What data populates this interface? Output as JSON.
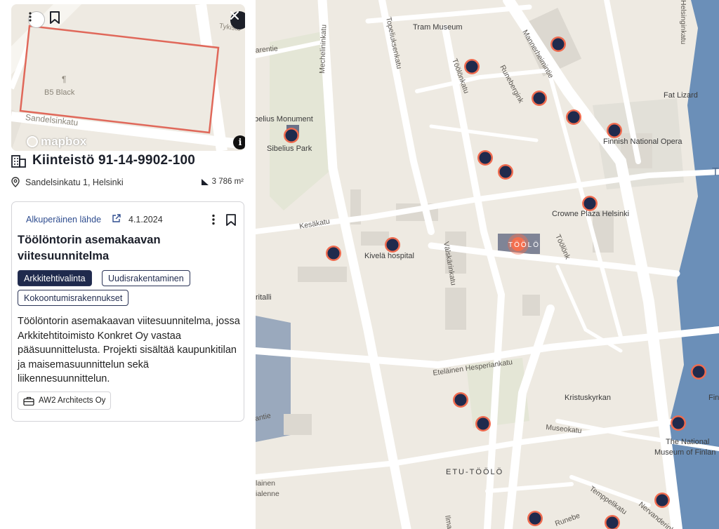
{
  "panel": {
    "title": "Kiinteistö 91-14-9902-100",
    "address": "Sandelsinkatu 1, Helsinki",
    "area": "3 786 m²",
    "mini_map": {
      "labels": {
        "street": "Sandelsinkatu",
        "restaurant": "B5 Black",
        "street_corner": "Tykistö"
      },
      "attribution": "mapbox",
      "info_label": "i"
    },
    "card": {
      "source_link": "Alkuperäinen lähde",
      "date": "4.1.2024",
      "title": "Töölöntorin asemakaavan viitesuunnitelma",
      "tags": [
        "Arkkitehtivalinta",
        "Uudisrakentaminen",
        "Kokoontumisrakennukset"
      ],
      "description": "Töölöntorin asemakaavan viitesuunnitelma, jossa Arkkitehtitoimisto Konkret Oy vastaa pääsuunnittelusta. Projekti sisältää kaupunkitilan ja maisemasuunnittelun sekä liikennesuunnittelun.",
      "architect": "AW2 Architects Oy"
    }
  },
  "map": {
    "labels": {
      "tram_museum": "Tram Museum",
      "sibelius_monument": "belius Monument",
      "sibelius_park": "Sibelius Park",
      "fat_lizard": "Fat Lizard",
      "opera": "Finnish National Opera",
      "crowne": "Crowne Plaza Helsinki",
      "kivela": "Kivelä hospital",
      "kristus": "Kristuskyrkan",
      "national_museum_1": "The National",
      "national_museum_2": "Museum of Finlan",
      "district": "ETU-TÖÖLÖ",
      "toolo_tag": "TÖÖLÖ",
      "fin": "Fin",
      "ritalli": "ritalli",
      "t_letter": "T"
    },
    "streets": {
      "mechelininkatu": "Mechelininkatu",
      "topeliuksenkatu": "Topeliuksenkatu",
      "toolonkatu": "Töölönkatu",
      "runeberginkatu": "Runebergink",
      "mannerheimintie": "Mannerheimintie",
      "helsinginkatu": "Helsinginkatu",
      "kesakatu": "Kesäkatu",
      "valskarinkatu": "Välskärinkatu",
      "etelainen_hesperiankatu": "Eteläinen Hesperiankatu",
      "museokatu": "Museokatu",
      "toolonk2": "Töölönk",
      "tempelikatu": "Temppelikatu",
      "nervanderinkatu": "Nervanderinkatu",
      "arentie": "arentie",
      "ilmarin": "Ilmarin",
      "lainen": "lainen",
      "antie": "antie",
      "valenne": "ialenne",
      "runeberg_short": "Runebe"
    },
    "colors": {
      "marker_fill": "#1f2a4d",
      "marker_ring": "#ef6b4f",
      "selected": "#f36f4f",
      "outline": "#e0685a"
    }
  }
}
